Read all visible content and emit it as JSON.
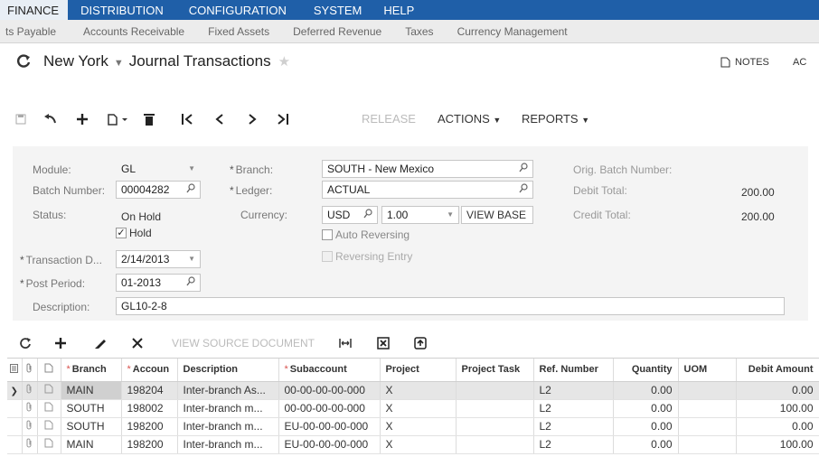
{
  "top_nav": [
    "FINANCE",
    "DISTRIBUTION",
    "CONFIGURATION",
    "SYSTEM",
    "HELP"
  ],
  "sub_nav": [
    "ts Payable",
    "Accounts Receivable",
    "Fixed Assets",
    "Deferred Revenue",
    "Taxes",
    "Currency Management"
  ],
  "header": {
    "branch_title": "New York",
    "screen_title": "Journal Transactions",
    "notes_label": "NOTES",
    "ac_label": "AC"
  },
  "toolbar": {
    "release_label": "RELEASE",
    "actions_label": "ACTIONS",
    "reports_label": "REPORTS"
  },
  "form": {
    "module_label": "Module:",
    "module_value": "GL",
    "batch_label": "Batch Number:",
    "batch_value": "00004282",
    "status_label": "Status:",
    "status_value": "On Hold",
    "hold_label": "Hold",
    "trandate_label": "Transaction D...",
    "trandate_value": "2/14/2013",
    "postperiod_label": "Post Period:",
    "postperiod_value": "01-2013",
    "description_label": "Description:",
    "description_value": "GL10-2-8",
    "branch_label": "Branch:",
    "branch_value": "SOUTH - New Mexico",
    "ledger_label": "Ledger:",
    "ledger_value": "ACTUAL",
    "currency_label": "Currency:",
    "currency_value": "USD",
    "rate_value": "1.00",
    "viewbase_label": "VIEW BASE",
    "auto_reversing_label": "Auto Reversing",
    "reversing_entry_label": "Reversing Entry",
    "orig_batch_label": "Orig. Batch Number:",
    "debit_total_label": "Debit Total:",
    "debit_total_value": "200.00",
    "credit_total_label": "Credit Total:",
    "credit_total_value": "200.00"
  },
  "grid_toolbar": {
    "view_source_label": "VIEW SOURCE DOCUMENT"
  },
  "grid": {
    "columns": [
      "Branch",
      "Accoun",
      "Description",
      "Subaccount",
      "Project",
      "Project Task",
      "Ref. Number",
      "Quantity",
      "UOM",
      "Debit Amount"
    ],
    "rows": [
      [
        "MAIN",
        "198204",
        "Inter-branch As...",
        "00-00-00-00-000",
        "X",
        "",
        "L2",
        "0.00",
        "",
        "0.00"
      ],
      [
        "SOUTH",
        "198002",
        "Inter-branch m...",
        "00-00-00-00-000",
        "X",
        "",
        "L2",
        "0.00",
        "",
        "100.00"
      ],
      [
        "SOUTH",
        "198200",
        "Inter-branch m...",
        "EU-00-00-00-000",
        "X",
        "",
        "L2",
        "0.00",
        "",
        "0.00"
      ],
      [
        "MAIN",
        "198200",
        "Inter-branch m...",
        "EU-00-00-00-000",
        "X",
        "",
        "L2",
        "0.00",
        "",
        "100.00"
      ]
    ]
  }
}
